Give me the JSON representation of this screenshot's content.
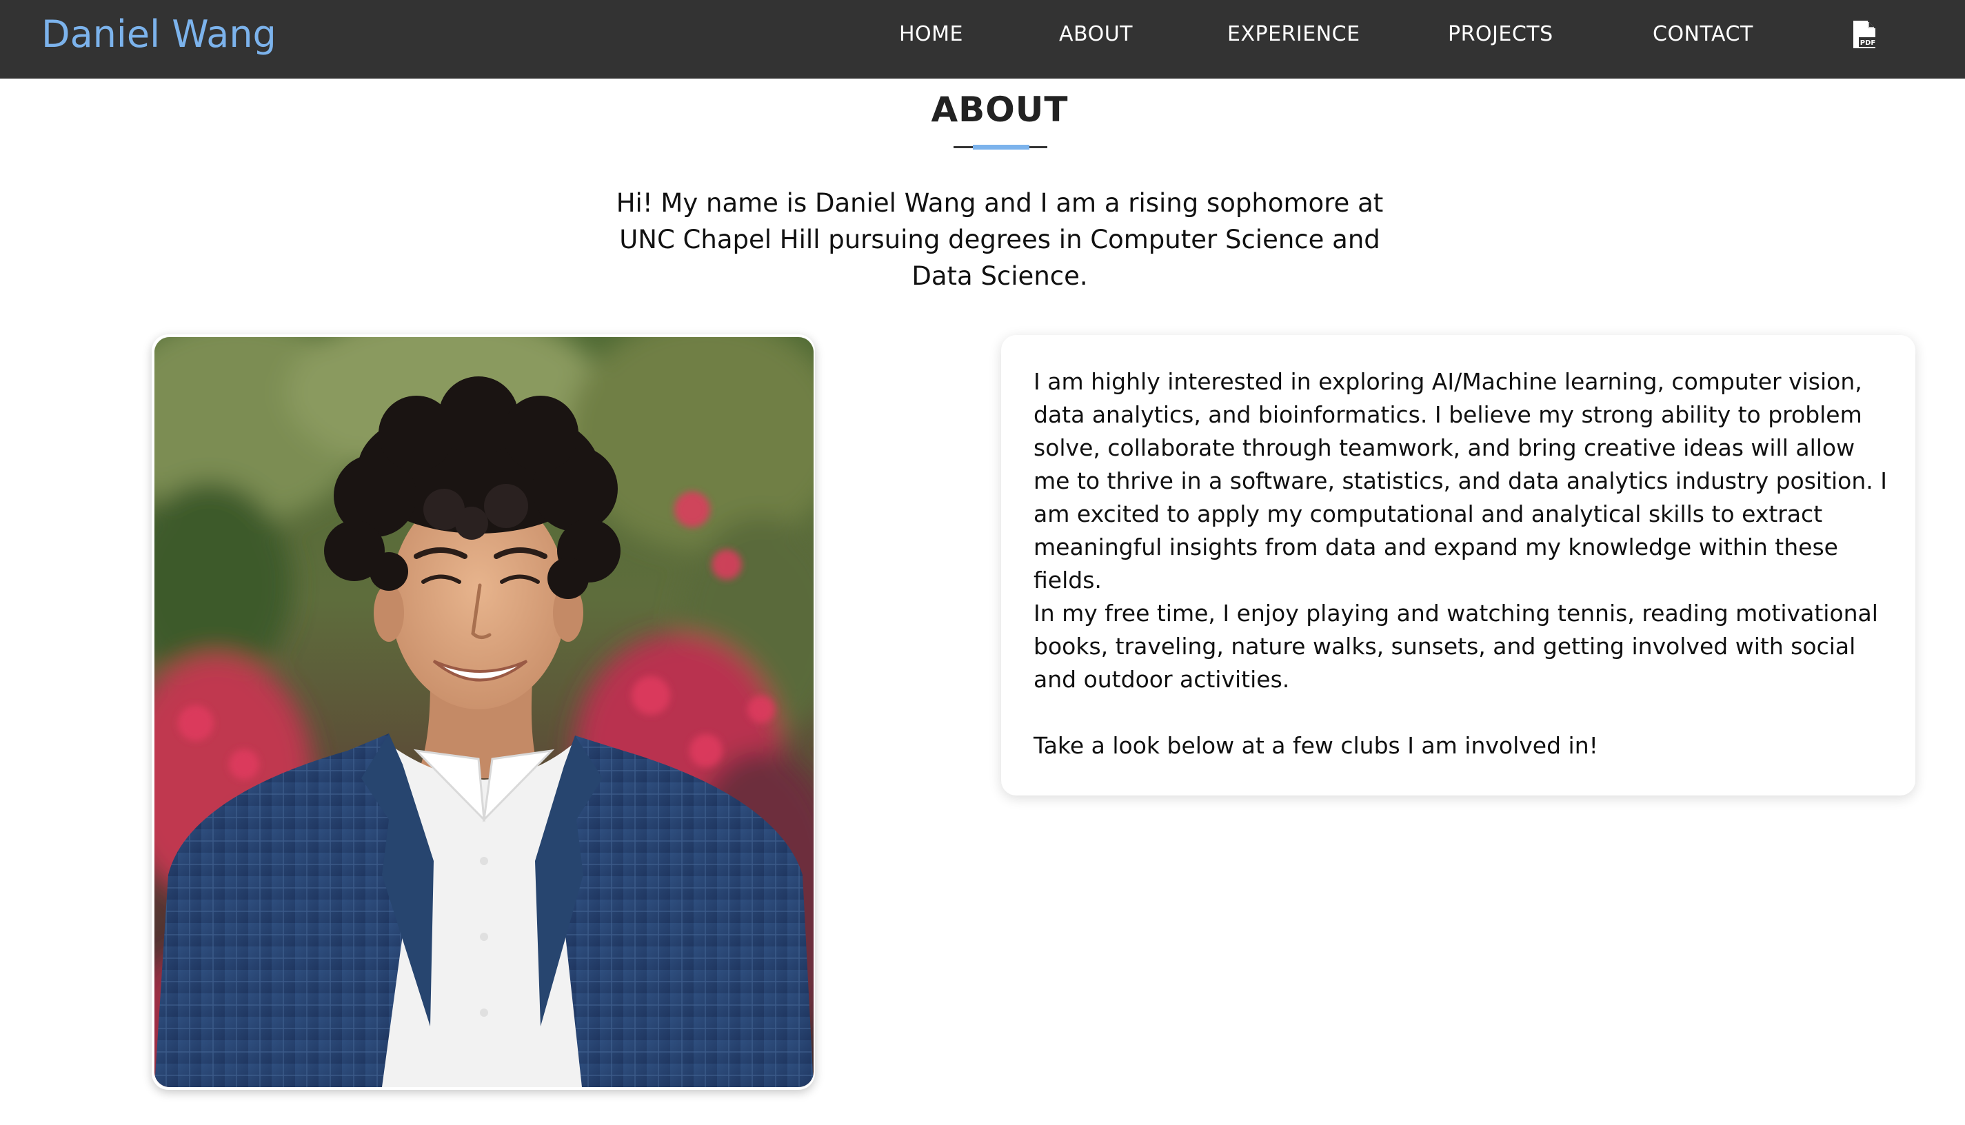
{
  "navbar": {
    "brand": "Daniel Wang",
    "links": [
      {
        "label": "HOME"
      },
      {
        "label": "ABOUT"
      },
      {
        "label": "EXPERIENCE"
      },
      {
        "label": "PROJECTS"
      },
      {
        "label": "CONTACT"
      }
    ],
    "resume_icon": "pdf-file-icon",
    "resume_icon_text": "PDF"
  },
  "about": {
    "title": "ABOUT",
    "intro": "Hi! My name is Daniel Wang and I am a rising sophomore at UNC Chapel Hill pursuing degrees in Computer Science and Data Science.",
    "paragraphs": [
      "I am highly interested in exploring AI/Machine learning, computer vision, data analytics, and bioinformatics. I believe my strong ability to problem solve, collaborate through teamwork, and bring creative ideas will allow me to thrive in a software, statistics, and data analytics industry position. I am excited to apply my computational and analytical skills to extract meaningful insights from data and expand my knowledge within these fields.",
      "In my free time, I enjoy playing and watching tennis, reading motivational books, traveling, nature walks, sunsets, and getting involved with social and outdoor activities.",
      "Take a look below at a few clubs I am involved in!"
    ]
  },
  "colors": {
    "navbar_bg": "#333333",
    "brand": "#7cb3ec",
    "accent": "#7cb3ec",
    "text": "#111111"
  }
}
